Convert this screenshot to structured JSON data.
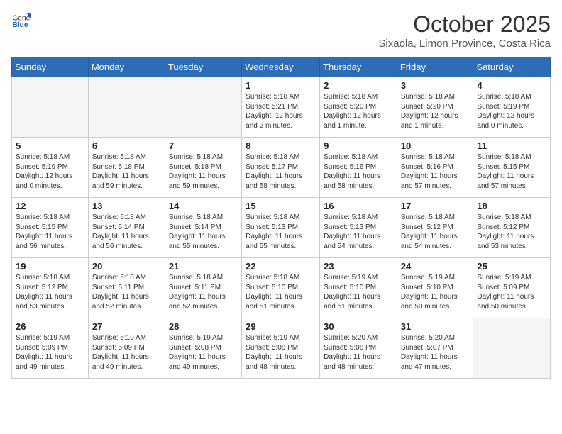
{
  "header": {
    "logo_general": "General",
    "logo_blue": "Blue",
    "month": "October 2025",
    "location": "Sixaola, Limon Province, Costa Rica"
  },
  "weekdays": [
    "Sunday",
    "Monday",
    "Tuesday",
    "Wednesday",
    "Thursday",
    "Friday",
    "Saturday"
  ],
  "weeks": [
    [
      {
        "day": "",
        "info": ""
      },
      {
        "day": "",
        "info": ""
      },
      {
        "day": "",
        "info": ""
      },
      {
        "day": "1",
        "info": "Sunrise: 5:18 AM\nSunset: 5:21 PM\nDaylight: 12 hours\nand 2 minutes."
      },
      {
        "day": "2",
        "info": "Sunrise: 5:18 AM\nSunset: 5:20 PM\nDaylight: 12 hours\nand 1 minute."
      },
      {
        "day": "3",
        "info": "Sunrise: 5:18 AM\nSunset: 5:20 PM\nDaylight: 12 hours\nand 1 minute."
      },
      {
        "day": "4",
        "info": "Sunrise: 5:18 AM\nSunset: 5:19 PM\nDaylight: 12 hours\nand 0 minutes."
      }
    ],
    [
      {
        "day": "5",
        "info": "Sunrise: 5:18 AM\nSunset: 5:19 PM\nDaylight: 12 hours\nand 0 minutes."
      },
      {
        "day": "6",
        "info": "Sunrise: 5:18 AM\nSunset: 5:18 PM\nDaylight: 11 hours\nand 59 minutes."
      },
      {
        "day": "7",
        "info": "Sunrise: 5:18 AM\nSunset: 5:18 PM\nDaylight: 11 hours\nand 59 minutes."
      },
      {
        "day": "8",
        "info": "Sunrise: 5:18 AM\nSunset: 5:17 PM\nDaylight: 11 hours\nand 58 minutes."
      },
      {
        "day": "9",
        "info": "Sunrise: 5:18 AM\nSunset: 5:16 PM\nDaylight: 11 hours\nand 58 minutes."
      },
      {
        "day": "10",
        "info": "Sunrise: 5:18 AM\nSunset: 5:16 PM\nDaylight: 11 hours\nand 57 minutes."
      },
      {
        "day": "11",
        "info": "Sunrise: 5:18 AM\nSunset: 5:15 PM\nDaylight: 11 hours\nand 57 minutes."
      }
    ],
    [
      {
        "day": "12",
        "info": "Sunrise: 5:18 AM\nSunset: 5:15 PM\nDaylight: 11 hours\nand 56 minutes."
      },
      {
        "day": "13",
        "info": "Sunrise: 5:18 AM\nSunset: 5:14 PM\nDaylight: 11 hours\nand 56 minutes."
      },
      {
        "day": "14",
        "info": "Sunrise: 5:18 AM\nSunset: 5:14 PM\nDaylight: 11 hours\nand 55 minutes."
      },
      {
        "day": "15",
        "info": "Sunrise: 5:18 AM\nSunset: 5:13 PM\nDaylight: 11 hours\nand 55 minutes."
      },
      {
        "day": "16",
        "info": "Sunrise: 5:18 AM\nSunset: 5:13 PM\nDaylight: 11 hours\nand 54 minutes."
      },
      {
        "day": "17",
        "info": "Sunrise: 5:18 AM\nSunset: 5:12 PM\nDaylight: 11 hours\nand 54 minutes."
      },
      {
        "day": "18",
        "info": "Sunrise: 5:18 AM\nSunset: 5:12 PM\nDaylight: 11 hours\nand 53 minutes."
      }
    ],
    [
      {
        "day": "19",
        "info": "Sunrise: 5:18 AM\nSunset: 5:12 PM\nDaylight: 11 hours\nand 53 minutes."
      },
      {
        "day": "20",
        "info": "Sunrise: 5:18 AM\nSunset: 5:11 PM\nDaylight: 11 hours\nand 52 minutes."
      },
      {
        "day": "21",
        "info": "Sunrise: 5:18 AM\nSunset: 5:11 PM\nDaylight: 11 hours\nand 52 minutes."
      },
      {
        "day": "22",
        "info": "Sunrise: 5:18 AM\nSunset: 5:10 PM\nDaylight: 11 hours\nand 51 minutes."
      },
      {
        "day": "23",
        "info": "Sunrise: 5:19 AM\nSunset: 5:10 PM\nDaylight: 11 hours\nand 51 minutes."
      },
      {
        "day": "24",
        "info": "Sunrise: 5:19 AM\nSunset: 5:10 PM\nDaylight: 11 hours\nand 50 minutes."
      },
      {
        "day": "25",
        "info": "Sunrise: 5:19 AM\nSunset: 5:09 PM\nDaylight: 11 hours\nand 50 minutes."
      }
    ],
    [
      {
        "day": "26",
        "info": "Sunrise: 5:19 AM\nSunset: 5:09 PM\nDaylight: 11 hours\nand 49 minutes."
      },
      {
        "day": "27",
        "info": "Sunrise: 5:19 AM\nSunset: 5:09 PM\nDaylight: 11 hours\nand 49 minutes."
      },
      {
        "day": "28",
        "info": "Sunrise: 5:19 AM\nSunset: 5:08 PM\nDaylight: 11 hours\nand 49 minutes."
      },
      {
        "day": "29",
        "info": "Sunrise: 5:19 AM\nSunset: 5:08 PM\nDaylight: 11 hours\nand 48 minutes."
      },
      {
        "day": "30",
        "info": "Sunrise: 5:20 AM\nSunset: 5:08 PM\nDaylight: 11 hours\nand 48 minutes."
      },
      {
        "day": "31",
        "info": "Sunrise: 5:20 AM\nSunset: 5:07 PM\nDaylight: 11 hours\nand 47 minutes."
      },
      {
        "day": "",
        "info": ""
      }
    ]
  ]
}
